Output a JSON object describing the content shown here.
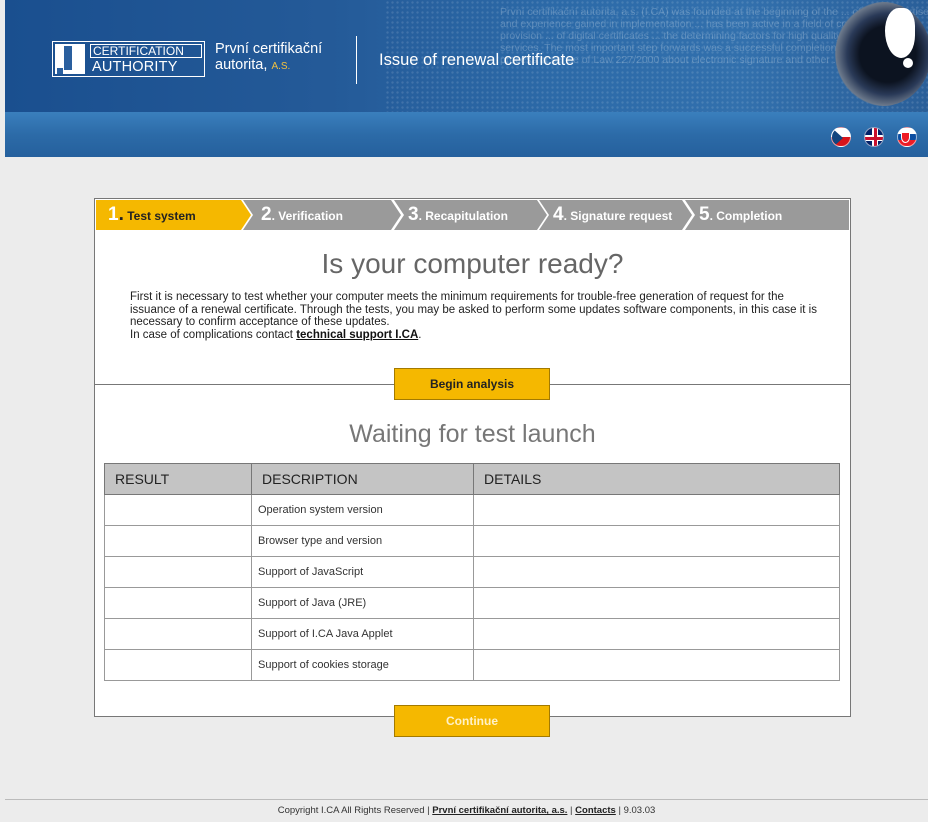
{
  "header": {
    "logo_line1": "CERTIFICATION",
    "logo_line2": "AUTHORITY",
    "company_name_line1": "První certifikační",
    "company_name_line2": "autorita,",
    "company_suffix": "A.S.",
    "page_title": "Issue of renewal certificate",
    "background_text": "První certifikační autorita, a.s. (I.CA) was founded at the beginning of the ... of own expertise and experience gained in implementation ... has been active in a field of commercial provision ... of digital certificates ... the determining factors for high quality of provided services. The most important step forwards was a successful completion of accreditation process in sense of Law 227/2000 about electronic signature and other ... the Office for",
    "languages": [
      "Czech",
      "English",
      "Slovak"
    ]
  },
  "steps": [
    {
      "num": "1",
      "label": "Test system",
      "active": true
    },
    {
      "num": "2",
      "label": "Verification",
      "active": false
    },
    {
      "num": "3",
      "label": "Recapitulation",
      "active": false
    },
    {
      "num": "4",
      "label": "Signature request",
      "active": false
    },
    {
      "num": "5",
      "label": "Completion",
      "active": false
    }
  ],
  "main": {
    "heading": "Is your computer ready?",
    "intro_text": "First it is necessary to test whether your computer meets the minimum requirements for trouble-free generation of request for the issuance of a renewal certificate. Through the tests, you may be asked to perform some updates software components, in this case it is necessary to confirm acceptance of these updates.",
    "support_prefix": "In case of complications contact ",
    "support_link": "technical support I.CA",
    "support_suffix": ".",
    "begin_button": "Begin analysis",
    "status_heading": "Waiting for test launch",
    "continue_button": "Continue"
  },
  "table": {
    "headers": [
      "RESULT",
      "DESCRIPTION",
      "DETAILS"
    ],
    "rows": [
      {
        "result": "",
        "description": "Operation system version",
        "details": ""
      },
      {
        "result": "",
        "description": "Browser type and version",
        "details": ""
      },
      {
        "result": "",
        "description": "Support of JavaScript",
        "details": ""
      },
      {
        "result": "",
        "description": "Support of Java (JRE)",
        "details": ""
      },
      {
        "result": "",
        "description": "Support of I.CA Java Applet",
        "details": ""
      },
      {
        "result": "",
        "description": "Support of cookies storage",
        "details": ""
      }
    ]
  },
  "footer": {
    "copyright": "Copyright I.CA All Rights Reserved | ",
    "company_link": "První certifikační autorita, a.s.",
    "separator": " | ",
    "contacts_link": "Contacts",
    "version": " | 9.03.03"
  },
  "colors": {
    "accent": "#f5b800",
    "header_blue": "#2d5f9e",
    "step_inactive": "#9a9a9a"
  }
}
